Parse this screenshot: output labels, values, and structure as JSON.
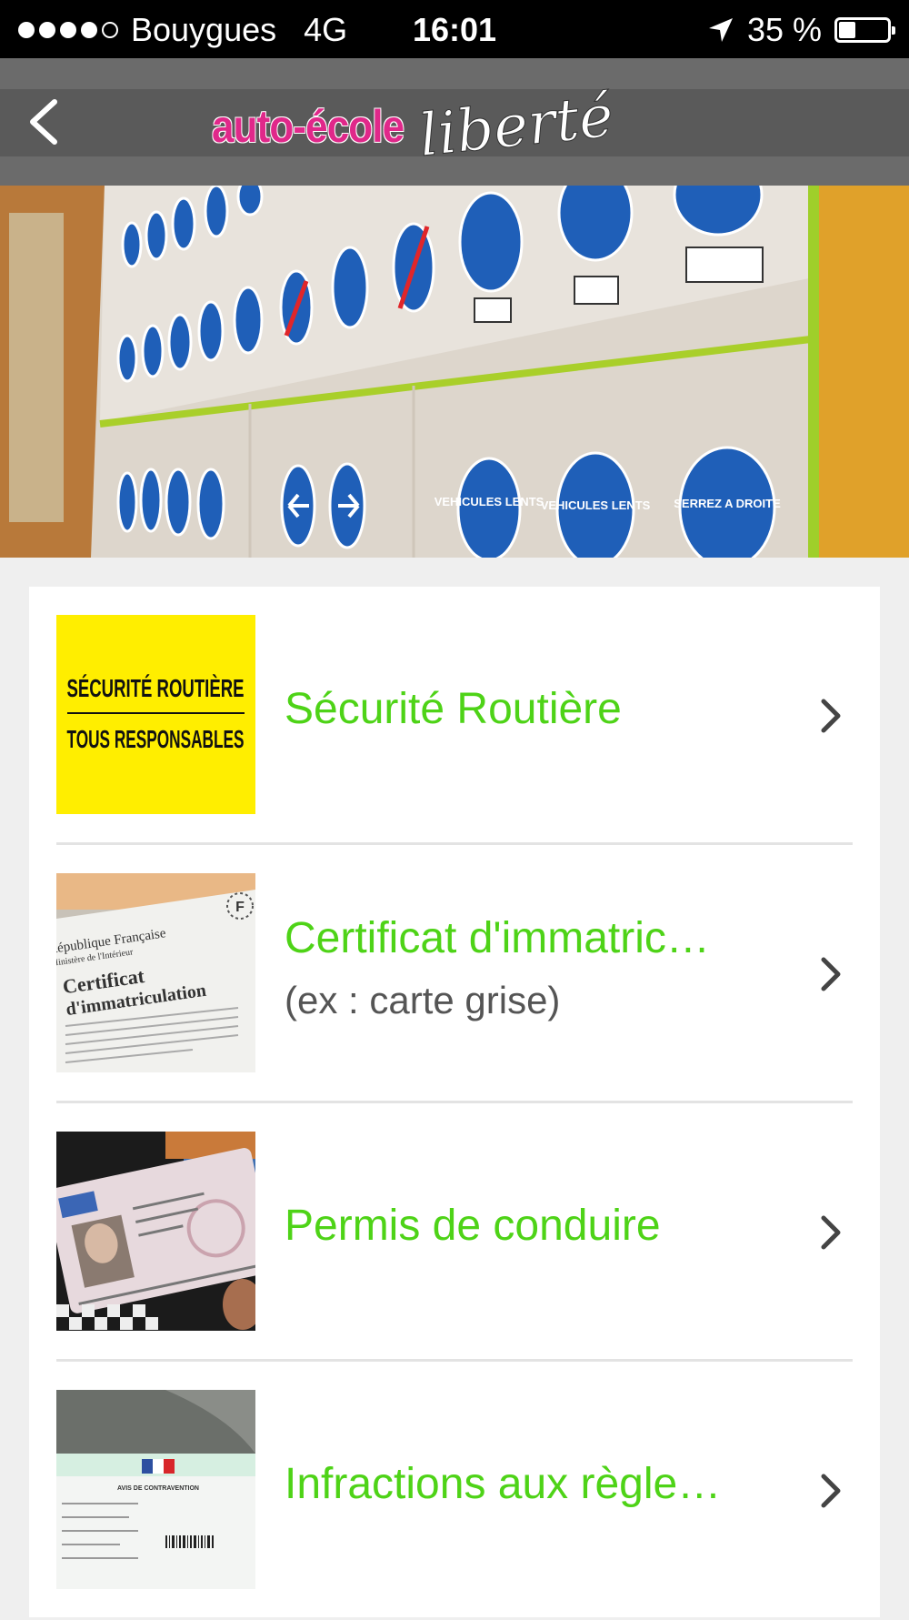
{
  "status_bar": {
    "carrier": "Bouygues",
    "network": "4G",
    "time": "16:01",
    "battery": "35 %",
    "battery_level": 0.35,
    "signal_bars_filled": 4,
    "signal_bars_total": 5
  },
  "nav": {
    "back_icon": "chevron-left-icon",
    "logo_main": "auto-école",
    "logo_script": "liberté",
    "logo_main_color": "#e0288a"
  },
  "hero": {
    "sign_labels": [
      "VEHICULES LENTS",
      "VEHICULES LENTS",
      "SERREZ A DROITE"
    ]
  },
  "colors": {
    "title_green": "#4ed317",
    "background": "#efefef",
    "nav_gray": "#5a5a5a"
  },
  "list": {
    "items": [
      {
        "title": "Sécurité Routière",
        "subtitle": "",
        "thumb_text": [
          "SÉCURITÉ ROUTIÈRE",
          "TOUS RESPONSABLES"
        ]
      },
      {
        "title": "Certificat d'immatric…",
        "subtitle": "(ex : carte grise)",
        "thumb_text": [
          "République Française",
          "Ministère de l'Intérieur",
          "Certificat",
          "d'immatriculation",
          "F"
        ]
      },
      {
        "title": "Permis de conduire",
        "subtitle": "",
        "thumb_text": []
      },
      {
        "title": "Infractions aux règle…",
        "subtitle": "",
        "thumb_text": [
          "AVIS DE CONTRAVENTION"
        ]
      }
    ]
  }
}
